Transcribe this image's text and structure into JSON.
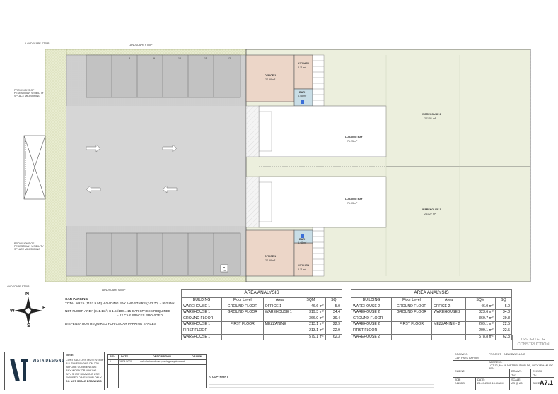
{
  "plan": {
    "labels": {
      "landscape_strip": "LANDSCAPE STRIP",
      "pedestrian_note": "PROVISIONS OF PEDESTRIAN VISIBILITY SPLACE MEASURING",
      "office2": "OFFICE 2",
      "office2_area": "27.98 m²",
      "office1": "OFFICE 1",
      "office1_area": "27.98 m²",
      "kitchen": "KITCHEN",
      "kitchen_area": "8.11 m²",
      "bath": "BATH",
      "bath_area": "6.48 m²",
      "loading_bay": "LOADING BAY",
      "loading_bay_area": "71.25 m²",
      "loading_bay2_area": "71.03 m²",
      "warehouse2": "WAREHOUSE 2",
      "warehouse2_area": "241.51 m²",
      "warehouse1": "WAREHOUSE 1",
      "warehouse1_area": "241.27 m²"
    },
    "space_numbers": [
      "8",
      "9",
      "10",
      "11",
      "12"
    ]
  },
  "compass": {
    "n": "N",
    "s": "S",
    "e": "E",
    "w": "W"
  },
  "car_parking": {
    "heading": "CAR PARKING",
    "line1": "TOTAL AREA (1157.9 M²) -LOADING BAY AND STAIRS (142.70) = 952.8M²",
    "line2": "NET FLOOR AREA (941.1m²) X 1.5 /100 = 15 CAR SPACES REQUIRED",
    "line3": "= 12 CAR SPACES PROVIDED",
    "line4": "DISPENSATION REQUIRED FOR 03 CAR PARKING SPACES"
  },
  "area_left": {
    "title": "AREA ANALYSIS",
    "headers": [
      "BUILDING",
      "Floor Level",
      "Area",
      "SQM",
      "SQ"
    ],
    "rows": [
      [
        "WAREHOUSE 1",
        "GROUND FLOOR",
        "OFFICE 1",
        "46.6 m²",
        "5.0"
      ],
      [
        "WAREHOUSE 1",
        "GROUND FLOOR",
        "WAREHOUSE 1",
        "319.3 m²",
        "34.4"
      ],
      [
        "GROUND FLOOR",
        "",
        "",
        "366.0 m²",
        "39.4"
      ],
      [
        "WAREHOUSE 1",
        "FIRST FLOOR",
        "MEZZANINE",
        "213.1 m²",
        "22.9"
      ],
      [
        "FIRST FLOOR",
        "",
        "",
        "213.1 m²",
        "22.9"
      ],
      [
        "WAREHOUSE 1",
        "",
        "",
        "579.1 m²",
        "62.3"
      ]
    ]
  },
  "area_right": {
    "title": "AREA ANALYSIS",
    "headers": [
      "BUILDING",
      "Floor Level",
      "Area",
      "SQM",
      "SQ"
    ],
    "rows": [
      [
        "WAREHOUSE 2",
        "GROUND FLOOR",
        "OFFICE 2",
        "46.0 m²",
        "5.0"
      ],
      [
        "WAREHOUSE 2",
        "GROUND FLOOR",
        "WAREHOUSE 2",
        "323.6 m²",
        "34.8"
      ],
      [
        "GROUND FLOOR",
        "",
        "",
        "369.7 m²",
        "39.8"
      ],
      [
        "WAREHOUSE 2",
        "FIRST FLOOR",
        "MEZZANINE - 2",
        "209.1 m²",
        "22.5"
      ],
      [
        "FIRST FLOOR",
        "",
        "",
        "209.1 m²",
        "22.5"
      ],
      [
        "WAREHOUSE 2",
        "",
        "",
        "578.8 m²",
        "62.3"
      ]
    ]
  },
  "issued": {
    "line1": "ISSUED FOR",
    "line2": "CONSTRUCTION"
  },
  "title_block": {
    "brand": "VISTA DESIGNS",
    "note_heading": "NOTE:",
    "note_lines": [
      "CONTRACTORS MUST VERIFY",
      "ALL DIMENSIONS ON JOB",
      "BEFORE COMMENCING",
      "ANY WORK OR MAKING",
      "ANY SHOP DRAWING USE",
      "FIGURED DIMENSION ONLY",
      "DO NOT SCALE DRAWINGS"
    ],
    "rev_headers": [
      "REV",
      "DATE",
      "DESCRIPTION",
      "DRAWN"
    ],
    "rev_row": [
      "1",
      "19/04/2020",
      "calculation of car parking requirement",
      ""
    ],
    "copyright": "© COPYRIGHT",
    "drawing_label": "DRAWING:",
    "drawing_value": "CAR PARK LAYOUT",
    "project_label": "PROJECT:",
    "project_value": "NEW DWELLING",
    "address_label": "ADDRESS:",
    "address_value": "LOT 12, No.46 DISTRIBUTION DR, MICKLEHAM VIC 3064",
    "client_label": "CLIENT:",
    "drawn_label": "DRAWN:",
    "drawn_value": "YO",
    "check_label": "CHECK:",
    "check_value": "HC",
    "job_label": "JOB:",
    "job_value": "2415DS",
    "date_label": "DATE:",
    "date_value": "28-09-2020 13:31 AM",
    "scale_label": "SCALE:",
    "scale_value": "AS @ A3",
    "sheet_label": "SHEET:",
    "sheet_value": "A7.1"
  }
}
